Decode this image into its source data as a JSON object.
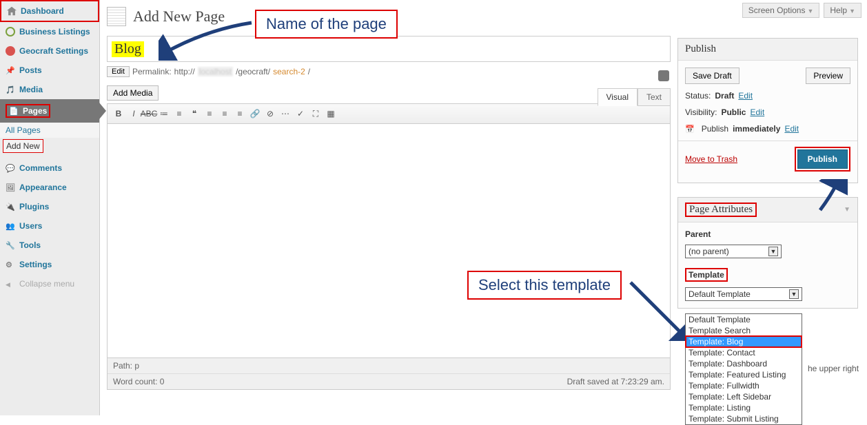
{
  "topButtons": {
    "screenOptions": "Screen Options",
    "help": "Help"
  },
  "sidebar": {
    "dashboard": "Dashboard",
    "businessListings": "Business Listings",
    "geocraft": "Geocraft Settings",
    "posts": "Posts",
    "media": "Media",
    "pages": "Pages",
    "pagesSub": {
      "all": "All Pages",
      "addNew": "Add New"
    },
    "comments": "Comments",
    "appearance": "Appearance",
    "plugins": "Plugins",
    "users": "Users",
    "tools": "Tools",
    "settings": "Settings",
    "collapse": "Collapse menu"
  },
  "main": {
    "heading": "Add New Page",
    "titleValue": "Blog",
    "permalink": {
      "editBtn": "Edit",
      "label": "Permalink:",
      "prefix": "http://",
      "blur": "localhost",
      "mid": "/geocraft/",
      "slug": "search-2",
      "slash": "/"
    },
    "addMedia": "Add Media",
    "tabs": {
      "visual": "Visual",
      "text": "Text"
    },
    "footer": {
      "path": "Path: p",
      "wordCount": "Word count: 0",
      "saved": "Draft saved at 7:23:29 am."
    }
  },
  "publish": {
    "title": "Publish",
    "saveDraft": "Save Draft",
    "preview": "Preview",
    "statusLabel": "Status:",
    "statusValue": "Draft",
    "edit": "Edit",
    "visibilityLabel": "Visibility:",
    "visibilityValue": "Public",
    "publishLabel": "Publish",
    "publishValue": "immediately",
    "trash": "Move to Trash",
    "publishBtn": "Publish"
  },
  "pageAttributes": {
    "title": "Page Attributes",
    "parentLabel": "Parent",
    "parentValue": "(no parent)",
    "templateLabel": "Template",
    "templateValue": "Default Template",
    "options": [
      "Default Template",
      "Template Search",
      "Template: Blog",
      "Template: Contact",
      "Template: Dashboard",
      "Template: Featured Listing",
      "Template: Fullwidth",
      "Template: Left Sidebar",
      "Template: Listing",
      "Template: Submit Listing"
    ],
    "selectedIndex": 2
  },
  "truncated": "he upper right",
  "annotations": {
    "nameOfPage": "Name of the page",
    "selectTemplate": "Select this template"
  }
}
